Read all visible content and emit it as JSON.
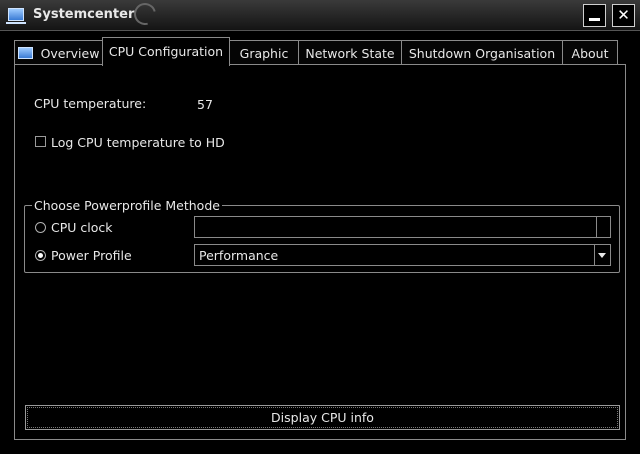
{
  "window": {
    "title": "Systemcenter",
    "minimize_icon": "minimize-icon",
    "close_icon": "close-icon",
    "close_glyph": "✕"
  },
  "tabs": [
    {
      "label": "Overview",
      "icon": "monitor-icon",
      "active": false
    },
    {
      "label": "CPU Configuration",
      "active": true
    },
    {
      "label": "Graphic",
      "active": false
    },
    {
      "label": "Network State",
      "active": false
    },
    {
      "label": "Shutdown Organisation",
      "active": false
    },
    {
      "label": "About",
      "active": false
    }
  ],
  "cpu": {
    "temperature_label": "CPU temperature:",
    "temperature_value": "57",
    "log_checkbox_label": "Log CPU temperature to HD",
    "log_checked": false
  },
  "powerprofile": {
    "group_title": "Choose Powerprofile Methode",
    "cpu_clock_label": "CPU clock",
    "cpu_clock_selected": false,
    "cpu_clock_value": "",
    "power_profile_label": "Power Profile",
    "power_profile_selected": true,
    "power_profile_value": "Performance"
  },
  "actions": {
    "display_cpu_info_label": "Display CPU info"
  }
}
